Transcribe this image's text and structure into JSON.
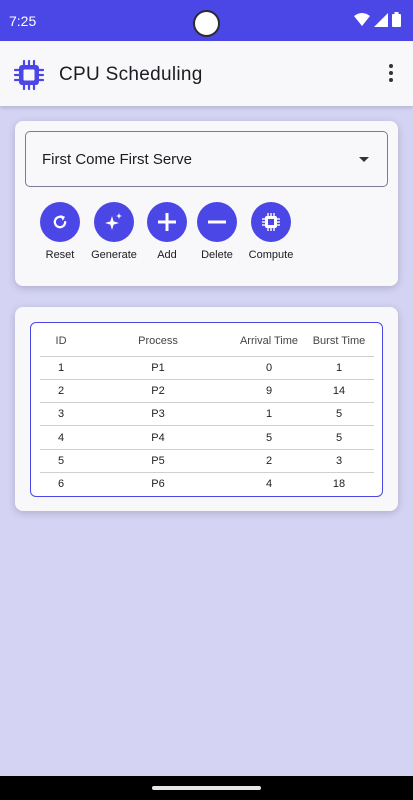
{
  "status_bar": {
    "time": "7:25",
    "accent": "#4b46e6"
  },
  "app_bar": {
    "title": "CPU Scheduling",
    "logo_icon": "chip-icon",
    "menu_icon": "more-vert-icon"
  },
  "algorithm": {
    "selected": "First Come First Serve"
  },
  "actions": [
    {
      "label": "Reset",
      "icon": "refresh-icon"
    },
    {
      "label": "Generate",
      "icon": "sparkle-icon"
    },
    {
      "label": "Add",
      "icon": "plus-icon"
    },
    {
      "label": "Delete",
      "icon": "minus-icon"
    },
    {
      "label": "Compute",
      "icon": "chip-icon"
    }
  ],
  "table": {
    "headers": [
      "ID",
      "Process",
      "Arrival Time",
      "Burst Time"
    ],
    "rows": [
      [
        "1",
        "P1",
        "0",
        "1"
      ],
      [
        "2",
        "P2",
        "9",
        "14"
      ],
      [
        "3",
        "P3",
        "1",
        "5"
      ],
      [
        "4",
        "P4",
        "5",
        "5"
      ],
      [
        "5",
        "P5",
        "2",
        "3"
      ],
      [
        "6",
        "P6",
        "4",
        "18"
      ]
    ]
  }
}
